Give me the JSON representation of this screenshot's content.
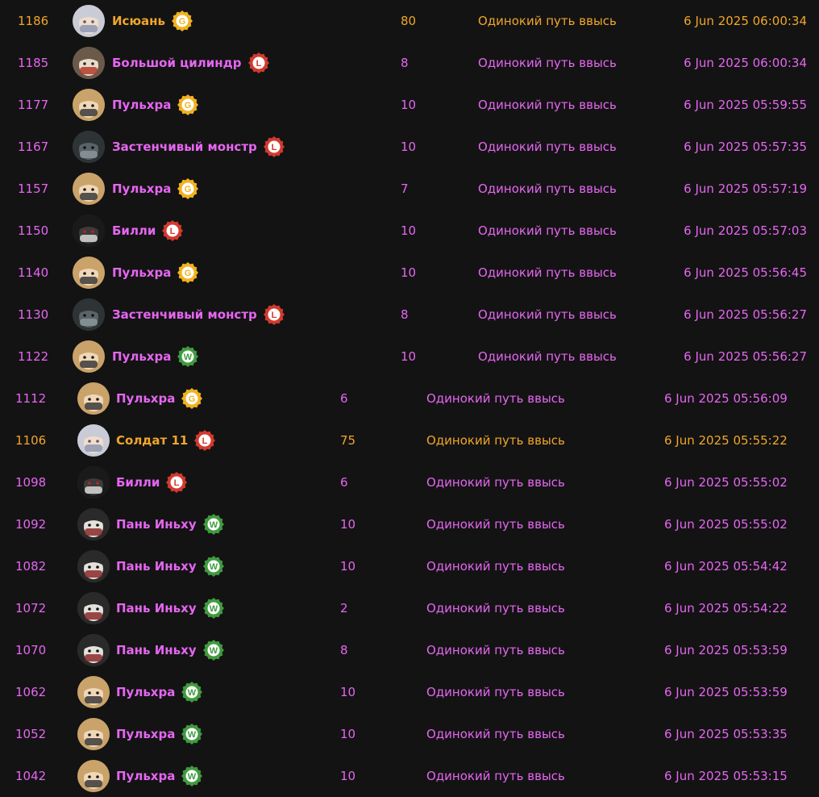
{
  "colors": {
    "background": "#131313",
    "text_default": "#e666f2",
    "text_highlight": "#f0a62a",
    "badge_g": "#f2b21e",
    "badge_l": "#d33a2e",
    "badge_w": "#3f9b3f"
  },
  "rows": [
    {
      "id": "1186",
      "avatar": "silver-hair-avatar",
      "name": "Исюань",
      "badge": "G",
      "qty": "80",
      "event": "Одинокий путь ввысь",
      "time": "6 Jun 2025 06:00:34",
      "highlight": true
    },
    {
      "id": "1185",
      "avatar": "cat-cylinder-avatar",
      "name": "Большой цилиндр",
      "badge": "L",
      "qty": "8",
      "event": "Одинокий путь ввысь",
      "time": "6 Jun 2025 06:00:34",
      "highlight": false
    },
    {
      "id": "1177",
      "avatar": "blonde-masked-avatar",
      "name": "Пульхра",
      "badge": "G",
      "qty": "10",
      "event": "Одинокий путь ввысь",
      "time": "6 Jun 2025 05:59:55",
      "highlight": false
    },
    {
      "id": "1167",
      "avatar": "robot-monster-avatar",
      "name": "Застенчивый монстр",
      "badge": "L",
      "qty": "10",
      "event": "Одинокий путь ввысь",
      "time": "6 Jun 2025 05:57:35",
      "highlight": false
    },
    {
      "id": "1157",
      "avatar": "blonde-masked-avatar",
      "name": "Пульхра",
      "badge": "G",
      "qty": "7",
      "event": "Одинокий путь ввысь",
      "time": "6 Jun 2025 05:57:19",
      "highlight": false
    },
    {
      "id": "1150",
      "avatar": "black-helmet-avatar",
      "name": "Билли",
      "badge": "L",
      "qty": "10",
      "event": "Одинокий путь ввысь",
      "time": "6 Jun 2025 05:57:03",
      "highlight": false
    },
    {
      "id": "1140",
      "avatar": "blonde-masked-avatar",
      "name": "Пульхра",
      "badge": "G",
      "qty": "10",
      "event": "Одинокий путь ввысь",
      "time": "6 Jun 2025 05:56:45",
      "highlight": false
    },
    {
      "id": "1130",
      "avatar": "robot-monster-avatar",
      "name": "Застенчивый монстр",
      "badge": "L",
      "qty": "8",
      "event": "Одинокий путь ввысь",
      "time": "6 Jun 2025 05:56:27",
      "highlight": false
    },
    {
      "id": "1122",
      "avatar": "blonde-masked-avatar",
      "name": "Пульхра",
      "badge": "W",
      "qty": "10",
      "event": "Одинокий путь ввысь",
      "time": "6 Jun 2025 05:56:27",
      "highlight": false
    },
    {
      "id": "1112",
      "avatar": "blonde-masked-avatar",
      "name": "Пульхра",
      "badge": "G",
      "qty": "6",
      "event": "Одинокий путь ввысь",
      "time": "6 Jun 2025 05:56:09",
      "highlight": false
    },
    {
      "id": "1106",
      "avatar": "silver-hair-avatar",
      "name": "Солдат 11",
      "badge": "L",
      "qty": "75",
      "event": "Одинокий путь ввысь",
      "time": "6 Jun 2025 05:55:22",
      "highlight": true
    },
    {
      "id": "1098",
      "avatar": "black-helmet-avatar",
      "name": "Билли",
      "badge": "L",
      "qty": "6",
      "event": "Одинокий путь ввысь",
      "time": "6 Jun 2025 05:55:02",
      "highlight": false
    },
    {
      "id": "1092",
      "avatar": "panda-avatar",
      "name": "Пань Иньху",
      "badge": "W",
      "qty": "10",
      "event": "Одинокий путь ввысь",
      "time": "6 Jun 2025 05:55:02",
      "highlight": false
    },
    {
      "id": "1082",
      "avatar": "panda-avatar",
      "name": "Пань Иньху",
      "badge": "W",
      "qty": "10",
      "event": "Одинокий путь ввысь",
      "time": "6 Jun 2025 05:54:42",
      "highlight": false
    },
    {
      "id": "1072",
      "avatar": "panda-avatar",
      "name": "Пань Иньху",
      "badge": "W",
      "qty": "2",
      "event": "Одинокий путь ввысь",
      "time": "6 Jun 2025 05:54:22",
      "highlight": false
    },
    {
      "id": "1070",
      "avatar": "panda-avatar",
      "name": "Пань Иньху",
      "badge": "W",
      "qty": "8",
      "event": "Одинокий путь ввысь",
      "time": "6 Jun 2025 05:53:59",
      "highlight": false
    },
    {
      "id": "1062",
      "avatar": "blonde-masked-avatar",
      "name": "Пульхра",
      "badge": "W",
      "qty": "10",
      "event": "Одинокий путь ввысь",
      "time": "6 Jun 2025 05:53:59",
      "highlight": false
    },
    {
      "id": "1052",
      "avatar": "blonde-masked-avatar",
      "name": "Пульхра",
      "badge": "W",
      "qty": "10",
      "event": "Одинокий путь ввысь",
      "time": "6 Jun 2025 05:53:35",
      "highlight": false
    },
    {
      "id": "1042",
      "avatar": "blonde-masked-avatar",
      "name": "Пульхра",
      "badge": "W",
      "qty": "10",
      "event": "Одинокий путь ввысь",
      "time": "6 Jun 2025 05:53:15",
      "highlight": false
    }
  ]
}
